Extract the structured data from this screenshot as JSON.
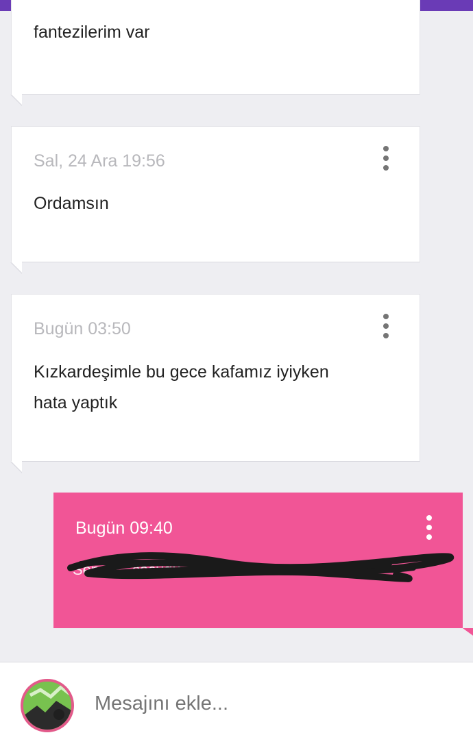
{
  "messages": [
    {
      "text": "fantezilerim var"
    },
    {
      "timestamp": "Sal, 24 Ara 19:56",
      "text": "Ordamsın"
    },
    {
      "timestamp": "Bugün 03:50",
      "line1": "Kızkardeşimle bu gece kafamız iyiyken",
      "line2": "hata yaptık"
    },
    {
      "timestamp": "Bugün 09:40",
      "text": "Senin ... çocuğu"
    }
  ],
  "composer": {
    "placeholder": "Mesajını ekle..."
  },
  "icons": {
    "menu": "more-vert-icon"
  },
  "colors": {
    "top_bar": "#6a3bb6",
    "sent_bubble": "#f15596",
    "background": "#eeeef2"
  }
}
